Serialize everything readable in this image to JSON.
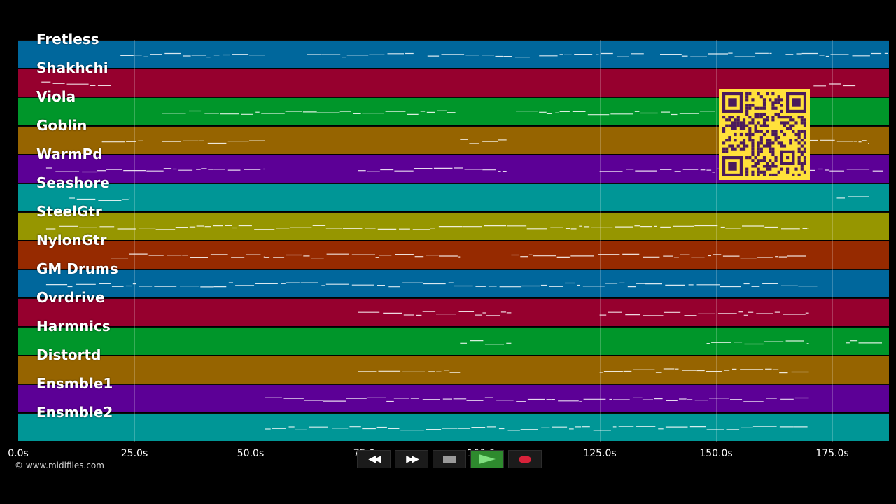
{
  "tracks": [
    {
      "name": "Fretless",
      "color": "#00679c"
    },
    {
      "name": "Shakhchi",
      "color": "#96002e"
    },
    {
      "name": "Viola",
      "color": "#00962a"
    },
    {
      "name": "Goblin",
      "color": "#966400"
    },
    {
      "name": "WarmPd",
      "color": "#5c0096"
    },
    {
      "name": "Seashore",
      "color": "#009696"
    },
    {
      "name": "SteelGtr",
      "color": "#969600"
    },
    {
      "name": "NylonGtr",
      "color": "#962a00"
    },
    {
      "name": "GM Drums",
      "color": "#00679c"
    },
    {
      "name": "Ovrdrive",
      "color": "#96002e"
    },
    {
      "name": "Harmnics",
      "color": "#00962a"
    },
    {
      "name": "Distortd",
      "color": "#966400"
    },
    {
      "name": "Ensmble1",
      "color": "#5c0096"
    },
    {
      "name": "Ensmble2",
      "color": "#009696"
    }
  ],
  "timeline": {
    "ticks": [
      "0.0s",
      "25.0s",
      "50.0s",
      "75.0s",
      "100.0s",
      "125.0s",
      "150.0s",
      "175.0s"
    ],
    "tick_seconds": [
      0,
      25,
      50,
      75,
      100,
      125,
      150,
      175
    ],
    "duration_seconds": 187.0
  },
  "note_segments": [
    [
      [
        22,
        53
      ],
      [
        62,
        85
      ],
      [
        88,
        110
      ],
      [
        112,
        135
      ],
      [
        138,
        162
      ],
      [
        165,
        187
      ]
    ],
    [
      [
        5,
        20
      ],
      [
        171,
        180
      ]
    ],
    [
      [
        31,
        94
      ],
      [
        107,
        150
      ]
    ],
    [
      [
        18,
        27
      ],
      [
        31,
        53
      ],
      [
        95,
        105
      ],
      [
        170,
        183
      ]
    ],
    [
      [
        6,
        53
      ],
      [
        73,
        105
      ],
      [
        125,
        186
      ]
    ],
    [
      [
        11,
        24
      ],
      [
        176,
        183
      ]
    ],
    [
      [
        6,
        170
      ]
    ],
    [
      [
        20,
        53
      ],
      [
        53,
        95
      ],
      [
        106,
        170
      ]
    ],
    [
      [
        6,
        172
      ]
    ],
    [
      [
        73,
        106
      ],
      [
        125,
        170
      ]
    ],
    [
      [
        95,
        106
      ],
      [
        148,
        170
      ],
      [
        178,
        186
      ]
    ],
    [
      [
        73,
        95
      ],
      [
        125,
        170
      ]
    ],
    [
      [
        53,
        170
      ]
    ],
    [
      [
        53,
        170
      ]
    ]
  ],
  "copyright": "© www.midifiles.com",
  "transport": {
    "rewind_icon": "rewind-icon",
    "fast_forward_icon": "fast-forward-icon",
    "stop_icon": "stop-icon",
    "play_icon": "play-icon",
    "record_icon": "record-icon"
  },
  "qr_code_icon": "qr-code-icon",
  "colors": {
    "background": "#000000",
    "note": "#ffffff",
    "qr_background": "#ffe13b",
    "qr_foreground": "#4a1a5c"
  }
}
